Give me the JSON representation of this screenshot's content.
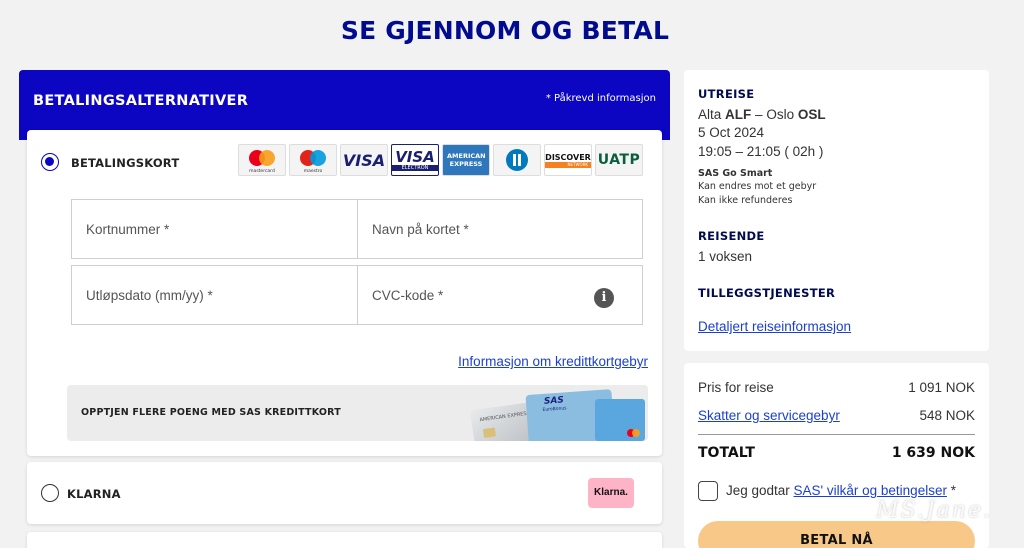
{
  "page": {
    "title": "SE GJENNOM OG BETAL"
  },
  "payment": {
    "header_title": "BETALINGSALTERNATIVER",
    "required_note": "* Påkrevd informasjon",
    "card_option": {
      "label": "BETALINGSKORT",
      "selected": true,
      "logos": [
        "mastercard",
        "maestro",
        "VISA",
        "VISA ELECTRON",
        "AMERICAN EXPRESS",
        "diners",
        "DISCOVER",
        "UATP"
      ],
      "logo_sublabels": {
        "mastercard": "mastercard",
        "maestro": "maestro",
        "electron": "ELECTRON",
        "discover_net": "NETWORK"
      }
    },
    "fields": {
      "card_number": "Kortnummer *",
      "name_on_card": "Navn på kortet *",
      "expiry": "Utløpsdato (mm/yy) *",
      "cvc": "CVC-kode *"
    },
    "fee_link": "Informasjon om kredittkortgebyr",
    "promo": {
      "text": "OPPTJEN FLERE POENG MED SAS KREDITTKORT",
      "card_text": "SAS",
      "card_subtext": "EuroBonus",
      "amex_text": "AMERICAN EXPRESS"
    },
    "klarna_option": {
      "label": "KLARNA",
      "badge": "Klarna."
    }
  },
  "summary": {
    "outbound_heading": "UTREISE",
    "route_from_city": "Alta",
    "route_from_code": "ALF",
    "route_sep": "–",
    "route_to_city": "Oslo",
    "route_to_code": "OSL",
    "date": "5 Oct 2024",
    "time": "19:05 – 21:05 ( 02h )",
    "fare_name": "SAS Go Smart",
    "fare_rule_1": "Kan endres mot et gebyr",
    "fare_rule_2": "Kan ikke refunderes",
    "travelers_heading": "REISENDE",
    "travelers": "1 voksen",
    "extras_heading": "TILLEGGSTJENESTER",
    "details_link": "Detaljert reiseinformasjon"
  },
  "price": {
    "trip_label": "Pris for reise",
    "trip_value": "1 091 NOK",
    "tax_label": "Skatter og servicegebyr",
    "tax_value": "548 NOK",
    "total_label": "TOTALT",
    "total_value": "1 639 NOK",
    "terms_prefix": "Jeg godtar ",
    "terms_link": "SAS' vilkår og betingelser",
    "terms_suffix": " *",
    "pay_button": "BETAL NÅ"
  },
  "watermark": "MS.Jane.",
  "colors": {
    "brand_blue": "#0c05c2",
    "title_blue": "#000b8f",
    "link_blue": "#1a3fd1",
    "pay_button": "#f7c887",
    "klarna_pink": "#ffb3c7"
  }
}
